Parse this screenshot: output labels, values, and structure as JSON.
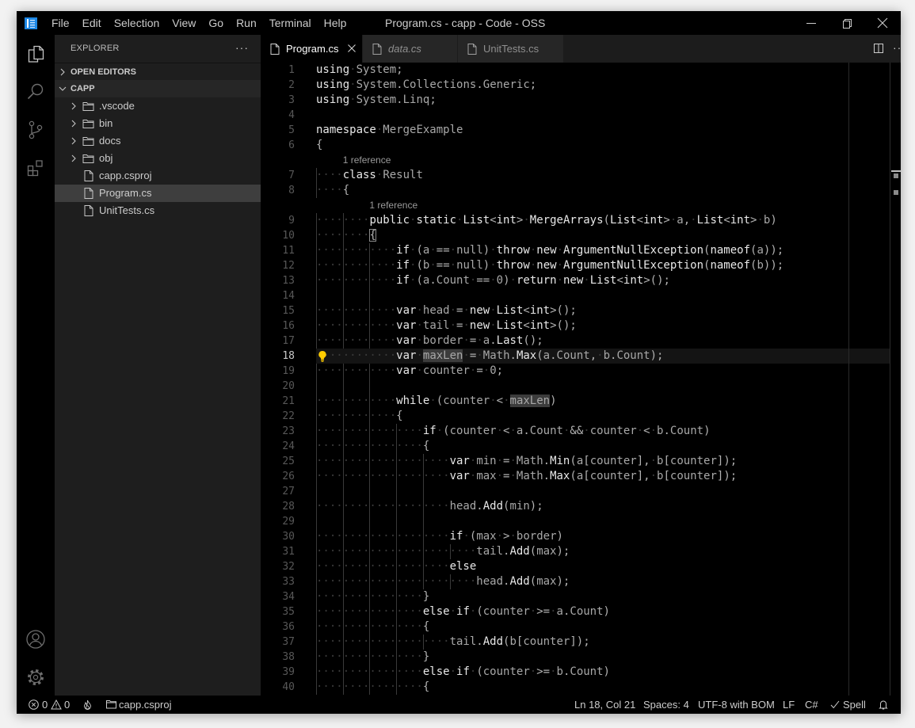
{
  "app": {
    "title": "Program.cs - capp - Code - OSS",
    "logo_icon": "code-oss-logo-icon",
    "brand_color": "#1e88e5"
  },
  "menu": {
    "items": [
      "File",
      "Edit",
      "Selection",
      "View",
      "Go",
      "Run",
      "Terminal",
      "Help"
    ]
  },
  "window_controls": {
    "minimize": "minimize-icon",
    "restore": "restore-icon",
    "close": "close-icon"
  },
  "activity_bar": {
    "top": [
      {
        "id": "explorer",
        "icon": "files-icon",
        "active": true
      },
      {
        "id": "search",
        "icon": "search-icon",
        "active": false
      },
      {
        "id": "source-control",
        "icon": "source-control-icon",
        "active": false
      },
      {
        "id": "extensions",
        "icon": "extensions-icon",
        "active": false
      }
    ],
    "bottom": [
      {
        "id": "accounts",
        "icon": "account-icon"
      },
      {
        "id": "manage",
        "icon": "gear-icon"
      }
    ]
  },
  "sidebar": {
    "title": "EXPLORER",
    "more_label": "···",
    "sections": [
      {
        "label": "OPEN EDITORS",
        "expanded": false
      },
      {
        "label": "CAPP",
        "expanded": true
      }
    ],
    "tree": [
      {
        "label": ".vscode",
        "type": "folder",
        "expanded": false
      },
      {
        "label": "bin",
        "type": "folder",
        "expanded": false
      },
      {
        "label": "docs",
        "type": "folder",
        "expanded": false
      },
      {
        "label": "obj",
        "type": "folder",
        "expanded": false
      },
      {
        "label": "capp.csproj",
        "type": "file"
      },
      {
        "label": "Program.cs",
        "type": "file",
        "selected": true
      },
      {
        "label": "UnitTests.cs",
        "type": "file"
      }
    ]
  },
  "tabs": [
    {
      "label": "Program.cs",
      "active": true,
      "preview": false
    },
    {
      "label": "data.cs",
      "active": false,
      "preview": true
    },
    {
      "label": "UnitTests.cs",
      "active": false,
      "preview": false
    }
  ],
  "editor_actions": {
    "split_icon": "split-editor-icon",
    "more_label": "···"
  },
  "editor": {
    "language": "C#",
    "first_line": 1,
    "current_line": 18,
    "highlight_word": "maxLen",
    "bracket_match": {
      "line": 10,
      "col": 9
    },
    "lightbulb_line": 18,
    "codelens": {
      "7": "1 reference",
      "9": "1 reference"
    },
    "lines": [
      "using System;",
      "using System.Collections.Generic;",
      "using System.Linq;",
      "",
      "namespace MergeExample",
      "{",
      "    class Result",
      "    {",
      "        public static List<int> MergeArrays(List<int> a, List<int> b)",
      "        {",
      "            if (a == null) throw new ArgumentNullException(nameof(a));",
      "            if (b == null) throw new ArgumentNullException(nameof(b));",
      "            if (a.Count == 0) return new List<int>();",
      "",
      "            var head = new List<int>();",
      "            var tail = new List<int>();",
      "            var border = a.Last();",
      "            var maxLen = Math.Max(a.Count, b.Count);",
      "            var counter = 0;",
      "",
      "            while (counter < maxLen)",
      "            {",
      "                if (counter < a.Count && counter < b.Count)",
      "                {",
      "                    var min = Math.Min(a[counter], b[counter]);",
      "                    var max = Math.Max(a[counter], b[counter]);",
      "",
      "                    head.Add(min);",
      "",
      "                    if (max > border)",
      "                        tail.Add(max);",
      "                    else",
      "                        head.Add(max);",
      "                }",
      "                else if (counter >= a.Count)",
      "                {",
      "                    tail.Add(b[counter]);",
      "                }",
      "                else if (counter >= b.Count)",
      "                {"
    ]
  },
  "status_bar": {
    "errors": "0",
    "warnings": "0",
    "project": "capp.csproj",
    "cursor_position": "Ln 18, Col 21",
    "indentation": "Spaces: 4",
    "encoding": "UTF-8 with BOM",
    "eol": "LF",
    "language": "C#",
    "spell": "Spell"
  }
}
